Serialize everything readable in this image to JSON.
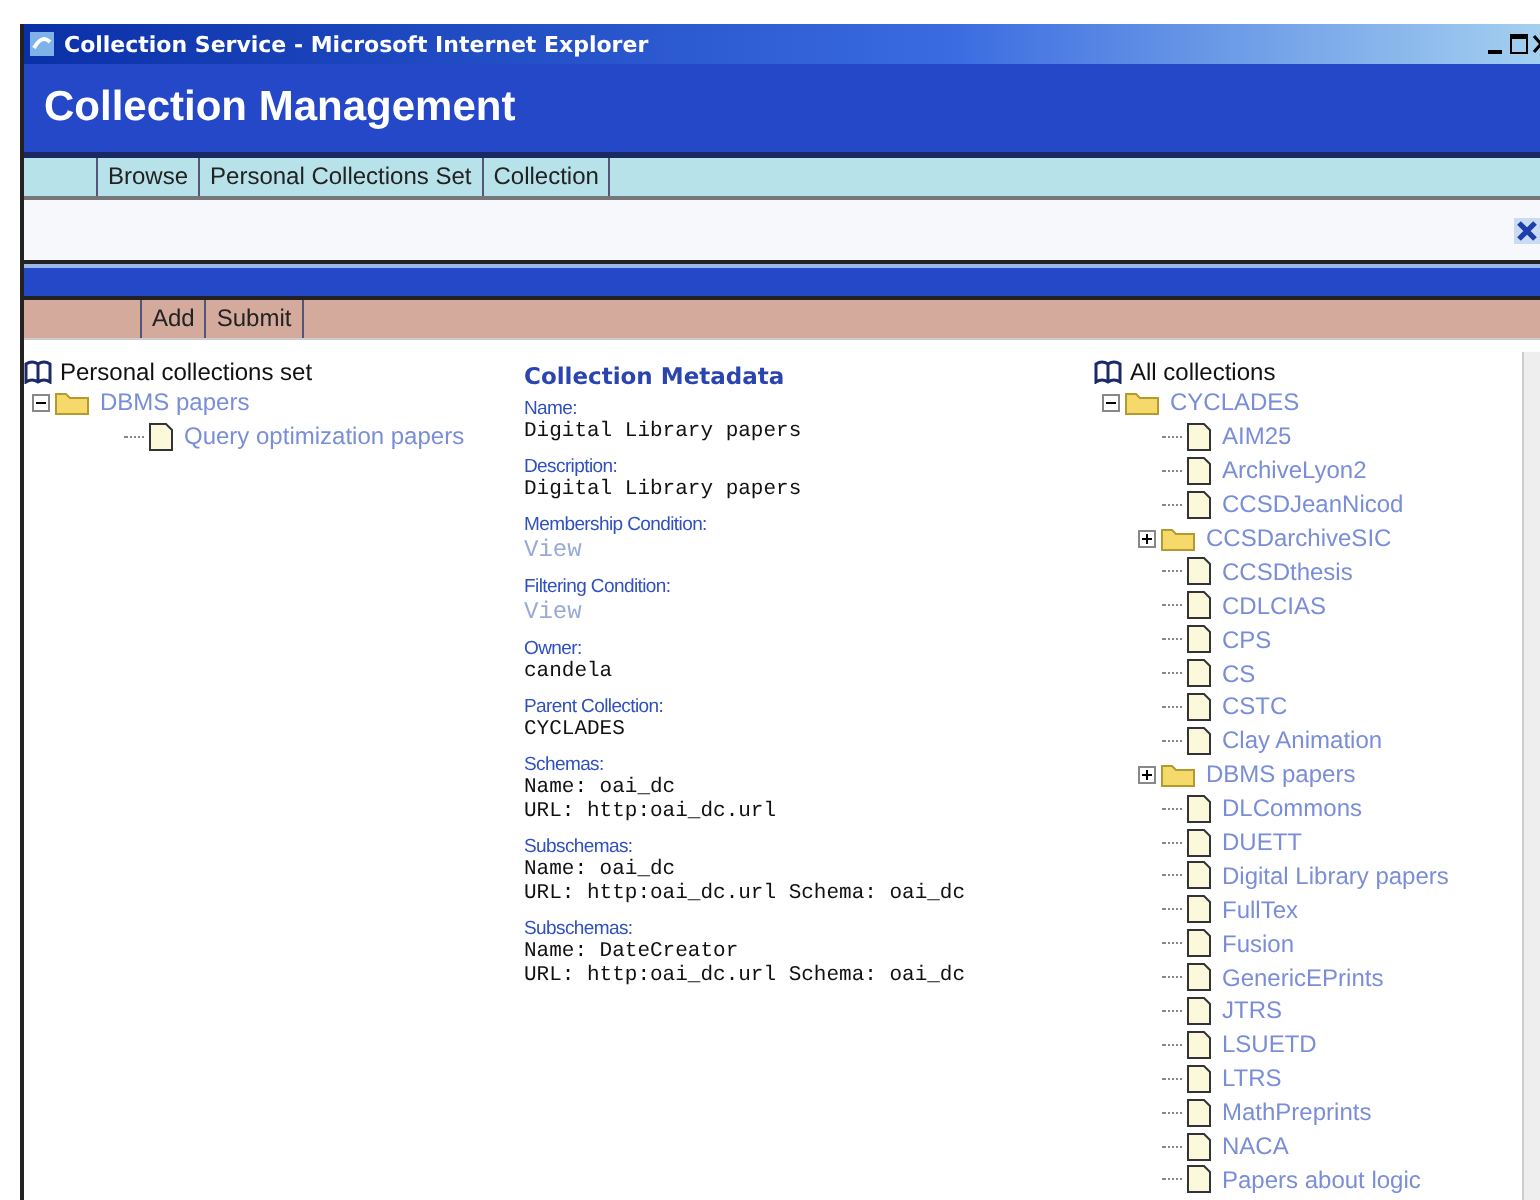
{
  "window": {
    "title": "Collection Service - Microsoft Internet Explorer"
  },
  "header": {
    "title": "Collection Management"
  },
  "tabs": [
    {
      "label": "Browse"
    },
    {
      "label": "Personal Collections Set"
    },
    {
      "label": "Collection"
    }
  ],
  "actions": [
    "Add",
    "Submit"
  ],
  "personal_tree": {
    "title": "Personal collections set",
    "items": [
      {
        "label": "DBMS papers",
        "kind": "folder",
        "expanded": true,
        "children": [
          {
            "label": "Query optimization papers",
            "kind": "doc"
          }
        ]
      }
    ]
  },
  "metadata": {
    "title": "Collection Metadata",
    "fields": [
      {
        "label": "Name:",
        "kind": "text",
        "lines": [
          "Digital Library papers"
        ]
      },
      {
        "label": "Description:",
        "kind": "text",
        "lines": [
          "Digital Library papers"
        ]
      },
      {
        "label": "Membership Condition:",
        "kind": "link",
        "lines": [
          "View"
        ]
      },
      {
        "label": "Filtering Condition:",
        "kind": "link",
        "lines": [
          "View"
        ]
      },
      {
        "label": "Owner:",
        "kind": "text",
        "lines": [
          "candela"
        ]
      },
      {
        "label": "Parent Collection:",
        "kind": "text",
        "lines": [
          "CYCLADES"
        ]
      },
      {
        "label": "Schemas:",
        "kind": "text",
        "lines": [
          "Name: oai_dc",
          "URL: http:oai_dc.url"
        ]
      },
      {
        "label": "Subschemas:",
        "kind": "text",
        "lines": [
          "Name: oai_dc",
          "URL: http:oai_dc.url Schema: oai_dc"
        ]
      },
      {
        "label": "Subschemas:",
        "kind": "text",
        "lines": [
          "Name: DateCreator",
          "URL: http:oai_dc.url Schema: oai_dc"
        ]
      }
    ]
  },
  "all_tree": {
    "title": "All collections",
    "items": [
      {
        "label": "CYCLADES",
        "kind": "folder",
        "expanded": true,
        "children": [
          {
            "label": "AIM25",
            "kind": "doc"
          },
          {
            "label": "ArchiveLyon2",
            "kind": "doc"
          },
          {
            "label": "CCSDJeanNicod",
            "kind": "doc"
          },
          {
            "label": "CCSDarchiveSIC",
            "kind": "folder",
            "expanded": false
          },
          {
            "label": "CCSDthesis",
            "kind": "doc"
          },
          {
            "label": "CDLCIAS",
            "kind": "doc"
          },
          {
            "label": "CPS",
            "kind": "doc"
          },
          {
            "label": "CS",
            "kind": "doc"
          },
          {
            "label": "CSTC",
            "kind": "doc"
          },
          {
            "label": "Clay Animation",
            "kind": "doc"
          },
          {
            "label": "DBMS papers",
            "kind": "folder",
            "expanded": false
          },
          {
            "label": "DLCommons",
            "kind": "doc"
          },
          {
            "label": "DUETT",
            "kind": "doc"
          },
          {
            "label": "Digital Library papers",
            "kind": "doc"
          },
          {
            "label": "FullTex",
            "kind": "doc"
          },
          {
            "label": "Fusion",
            "kind": "doc"
          },
          {
            "label": "GenericEPrints",
            "kind": "doc"
          },
          {
            "label": "JTRS",
            "kind": "doc"
          },
          {
            "label": "LSUETD",
            "kind": "doc"
          },
          {
            "label": "LTRS",
            "kind": "doc"
          },
          {
            "label": "MathPreprints",
            "kind": "doc"
          },
          {
            "label": "NACA",
            "kind": "doc"
          },
          {
            "label": "Papers about logic",
            "kind": "doc"
          }
        ]
      }
    ]
  }
}
